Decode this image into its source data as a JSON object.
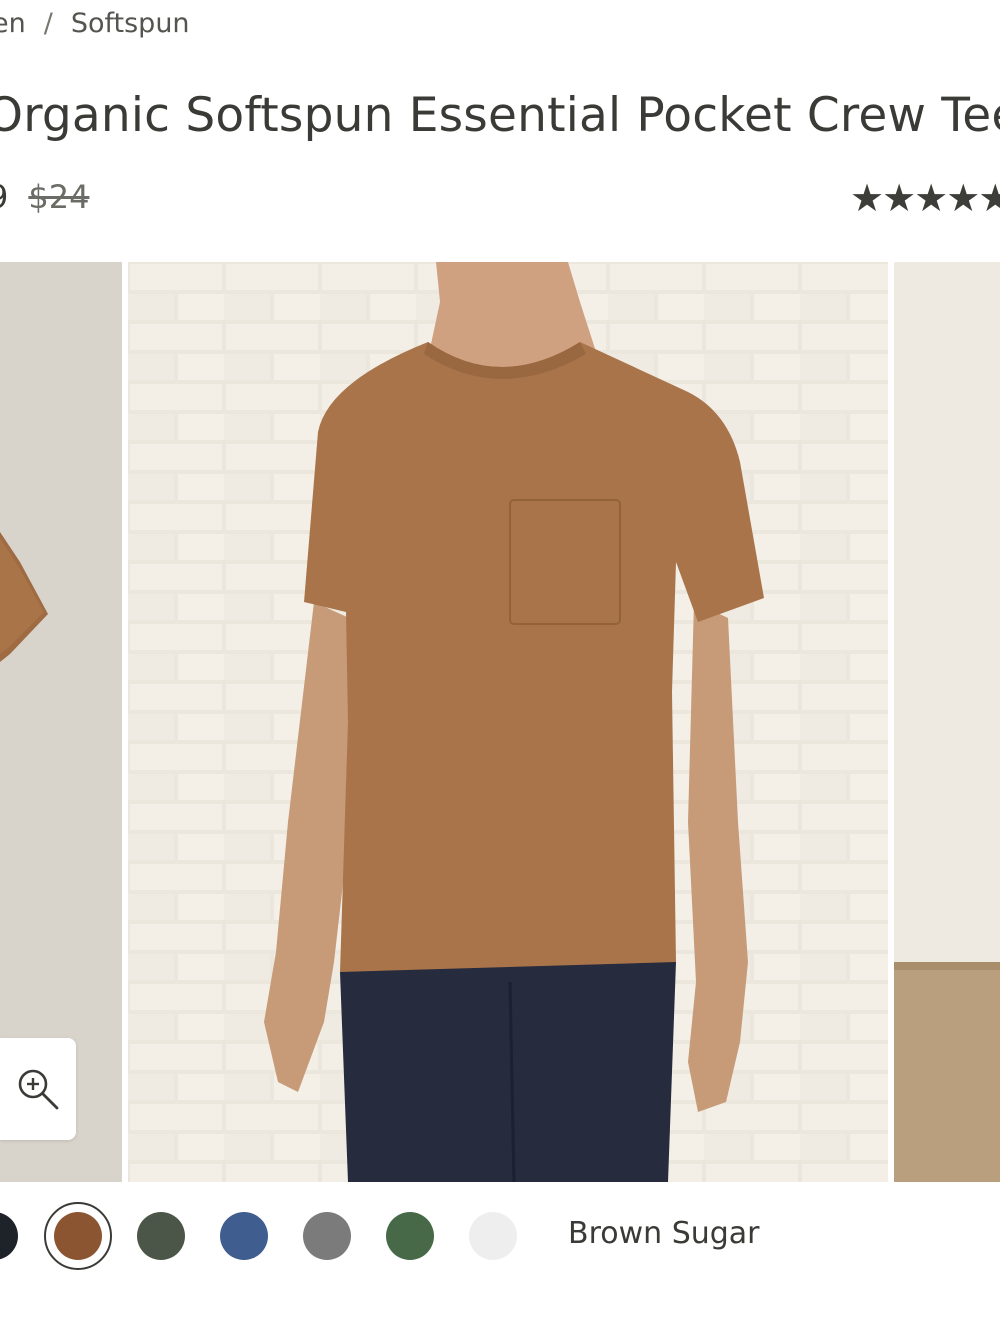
{
  "breadcrumb": {
    "items": [
      "en",
      "Softspun"
    ],
    "separator": "/"
  },
  "product": {
    "title": "Organic Softspun Essential Pocket Crew Tee",
    "price_sale": "9",
    "price_original": "$24",
    "rating_stars": "★★★★★"
  },
  "gallery": {
    "zoom_icon": "zoom-in-icon"
  },
  "swatches": {
    "selected_color_name": "Brown Sugar",
    "colors": [
      "#1e2229",
      "#8a5530",
      "#4b5648",
      "#3f5d8f",
      "#7b7b7b",
      "#476947",
      "#eeeeee"
    ]
  }
}
